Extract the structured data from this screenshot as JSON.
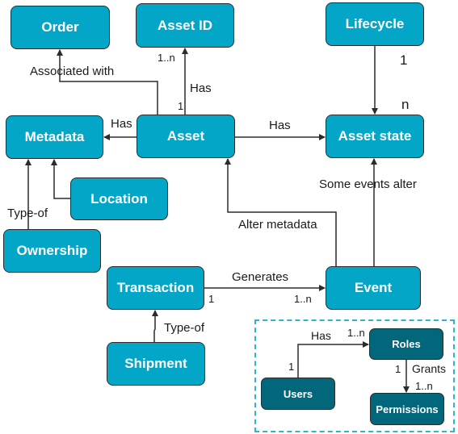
{
  "colors": {
    "node_fill": "#03a6c7",
    "node_dark_fill": "#02677a",
    "node_border": "#2b2b2b",
    "edge": "#2b2b2b",
    "group_border": "#2fb3d3"
  },
  "nodes": {
    "order": "Order",
    "asset_id": "Asset ID",
    "lifecycle": "Lifecycle",
    "metadata": "Metadata",
    "asset": "Asset",
    "asset_state": "Asset state",
    "location": "Location",
    "ownership": "Ownership",
    "transaction": "Transaction",
    "event": "Event",
    "shipment": "Shipment",
    "users": "Users",
    "roles": "Roles",
    "permissions": "Permissions"
  },
  "edges": {
    "asset_order": {
      "label": "Associated with"
    },
    "asset_assetid": {
      "label": "Has",
      "source_mult": "1",
      "target_mult": "1..n"
    },
    "asset_metadata": {
      "label": "Has"
    },
    "asset_assetstate": {
      "label": "Has"
    },
    "lifecycle_assetstate": {
      "source_mult": "1",
      "target_mult": "n"
    },
    "ownership_metadata": {
      "label": "Type-of"
    },
    "event_asset": {
      "label": "Alter metadata"
    },
    "event_assetstate": {
      "label": "Some events alter"
    },
    "transaction_event": {
      "label": "Generates",
      "source_mult": "1",
      "target_mult": "1..n"
    },
    "shipment_transaction": {
      "label": "Type-of"
    },
    "users_roles": {
      "label": "Has",
      "source_mult": "1",
      "target_mult": "1..n"
    },
    "roles_permissions": {
      "label": "Grants",
      "source_mult": "1",
      "target_mult": "1..n"
    }
  }
}
